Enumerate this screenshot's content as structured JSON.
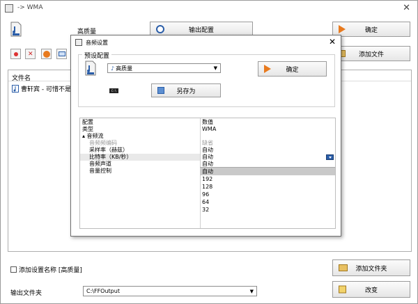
{
  "main": {
    "title": "-> WMA",
    "close": "✕",
    "preset_name": "高质量",
    "output_config_label": "输出配置",
    "ok_label": "确定",
    "add_file_label": "添加文件",
    "file_list_header": "文件名",
    "file_item": "曹轩宾 - 可惜不是你",
    "add_folder_label": "添加文件夹",
    "change_label": "改变",
    "add_setting_name": "添加设置名称 [高质量]",
    "output_folder_label": "输出文件夹",
    "output_folder_value": "C:\\FFOutput"
  },
  "dialog": {
    "title": "音频设置",
    "close": "✕",
    "group_label": "预设配置",
    "preset_value": "高质量",
    "ok_label": "确定",
    "save_as_label": "另存为",
    "cmd_text": "C:\\",
    "grid": {
      "header_col1": "配置",
      "header_col2": "数值",
      "rows": [
        {
          "name": "类型",
          "value": "WMA"
        },
        {
          "name": "▴ 音频流",
          "value": ""
        },
        {
          "name": "音频频编码",
          "value": "缺省"
        },
        {
          "name": "采样率（赫兹）",
          "value": "自动"
        },
        {
          "name": "比特率（KB/秒）",
          "value": "自动"
        },
        {
          "name": "音频声道",
          "value": "自动"
        },
        {
          "name": "音量控制",
          "value": ""
        }
      ],
      "options": [
        "192",
        "128",
        "96",
        "64",
        "32"
      ]
    }
  },
  "colors": {
    "ok_arrow": "#e87a1e",
    "accent_blue": "#2a5da8"
  }
}
